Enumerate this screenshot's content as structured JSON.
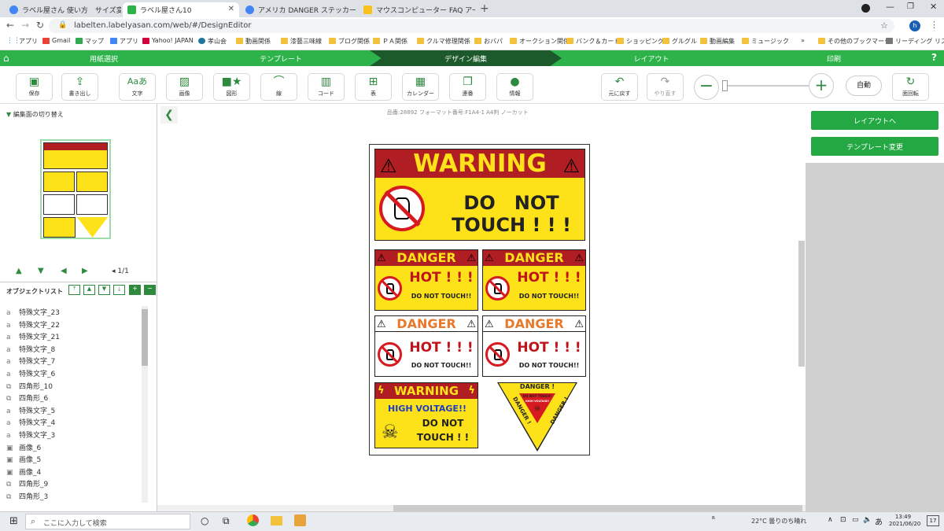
{
  "browser": {
    "tabs": [
      {
        "title": "ラベル屋さん 使い方　サイズ変更 - G",
        "active": false
      },
      {
        "title": "ラベル屋さん10",
        "active": true
      },
      {
        "title": "アメリカ DANGER ステッカー 画像 - G",
        "active": false
      },
      {
        "title": "マウスコンピューター FAQ アーカイブペー",
        "active": false
      }
    ],
    "url": "labelten.labelyasan.com/web/#/DesignEditor",
    "bookmarks": [
      "アプリ",
      "Gmail",
      "マップ",
      "アプリ",
      "Yahoo! JAPAN",
      "孝山会",
      "動画関係",
      "漆藝三味線",
      "ブログ関係",
      "ＰＡ関係",
      "クルマ修理関係",
      "おバパ",
      "オークション関係",
      "バンク＆カード",
      "ショッピング",
      "グルグル",
      "動画編集",
      "ミュージック"
    ],
    "bookmarks_more": "»",
    "other_bookmarks": "その他のブックマーク",
    "reading_list": "リーディング リスト",
    "avatar_letter": "h"
  },
  "steps": [
    "用紙選択",
    "テンプレート",
    "デザイン編集",
    "レイアウト",
    "印刷"
  ],
  "help": "?",
  "toolbar": {
    "save": "保存",
    "export": "書き出し",
    "text": "文字",
    "image": "画像",
    "shape": "図形",
    "line": "線",
    "code": "コード",
    "table": "表",
    "calendar": "カレンダー",
    "sequence": "連番",
    "info": "情報",
    "undo": "元に戻す",
    "redo": "やり直す",
    "auto": "自動",
    "rotate": "面回転"
  },
  "left": {
    "switch_title": "編集面の切り替え",
    "page_indicator": "1/1",
    "object_list_title": "オブジェクトリスト",
    "objects": [
      {
        "type": "text",
        "name": "特殊文字_23"
      },
      {
        "type": "text",
        "name": "特殊文字_22"
      },
      {
        "type": "text",
        "name": "特殊文字_21"
      },
      {
        "type": "text",
        "name": "特殊文字_8"
      },
      {
        "type": "text",
        "name": "特殊文字_7"
      },
      {
        "type": "text",
        "name": "特殊文字_6"
      },
      {
        "type": "shape",
        "name": "四角形_10"
      },
      {
        "type": "shape",
        "name": "四角形_6"
      },
      {
        "type": "text",
        "name": "特殊文字_5"
      },
      {
        "type": "text",
        "name": "特殊文字_4"
      },
      {
        "type": "text",
        "name": "特殊文字_3"
      },
      {
        "type": "image",
        "name": "画像_6"
      },
      {
        "type": "image",
        "name": "画像_5"
      },
      {
        "type": "image",
        "name": "画像_4"
      },
      {
        "type": "shape",
        "name": "四角形_9"
      },
      {
        "type": "shape",
        "name": "四角形_3"
      }
    ]
  },
  "canvas": {
    "product_info": "品番:28892 フォーマット番号:F1A4-1 A4判 ノーカット",
    "labels": {
      "warning": "WARNING",
      "do_not": "DO　NOT",
      "touch": "TOUCH ! ! !",
      "danger": "DANGER",
      "hot": "HOT ! ! !",
      "do_not_touch": "DO NOT TOUCH!!",
      "high_voltage": "HIGH VOLTAGE!!",
      "do_not_2": "DO NOT",
      "touch_2": "TOUCH ! !",
      "tri_danger_top": "DANGER !",
      "tri_dont_touch": "DO NOT TOUCH!",
      "tri_high_voltage": "HIGH VOLTAGE!",
      "tri_danger_side": "DANGER !"
    }
  },
  "right": {
    "to_layout": "レイアウトへ",
    "change_template": "テンプレート変更"
  },
  "taskbar": {
    "search_placeholder": "ここに入力して検索",
    "weather": "22°C  曇りのち晴れ",
    "ime": "あ",
    "time": "13:49",
    "date": "2021/06/20",
    "notif_count": "17"
  },
  "colors": {
    "green": "#2db34a",
    "dark_green": "#1c5a2c",
    "yellow": "#fde21a",
    "warning_red": "#b01d23",
    "danger_orange": "#e8792b"
  }
}
